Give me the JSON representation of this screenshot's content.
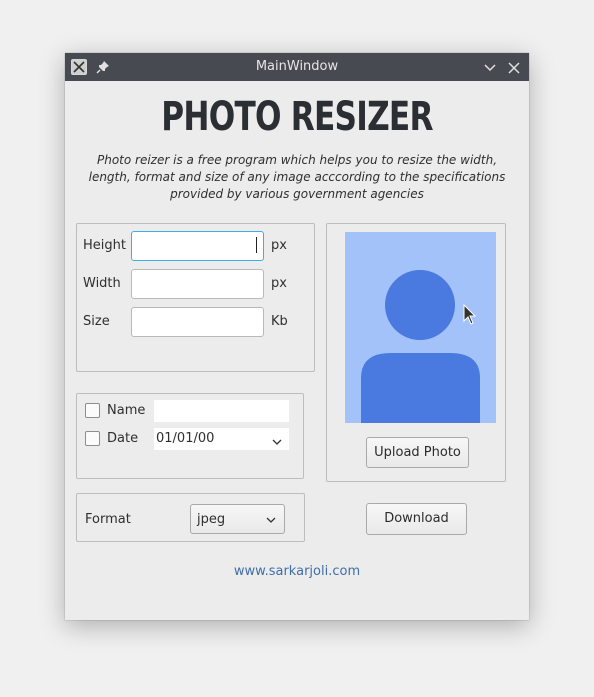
{
  "window": {
    "title": "MainWindow"
  },
  "header": {
    "title": "PHOTO RESIZER",
    "description": "Photo reizer is a free program which helps you to resize the width, length, format and size of any image acccording to the specifications provided by various government agencies"
  },
  "dimensions": {
    "height": {
      "label": "Height",
      "value": "",
      "unit": "px"
    },
    "width": {
      "label": "Width",
      "value": "",
      "unit": "px"
    },
    "size": {
      "label": "Size",
      "value": "",
      "unit": "Kb"
    }
  },
  "stamp": {
    "name": {
      "label": "Name",
      "checked": false,
      "value": ""
    },
    "date": {
      "label": "Date",
      "checked": false,
      "value": "01/01/00"
    }
  },
  "format": {
    "label": "Format",
    "selected": "jpeg"
  },
  "photo": {
    "upload_label": "Upload Photo"
  },
  "actions": {
    "download_label": "Download"
  },
  "footer": {
    "link": "www.sarkarjoli.com"
  },
  "colors": {
    "accent": "#3daee9",
    "avatar": "#4a7ae0",
    "avatar_bg": "#a4c2fa",
    "titlebar": "#474b51"
  }
}
